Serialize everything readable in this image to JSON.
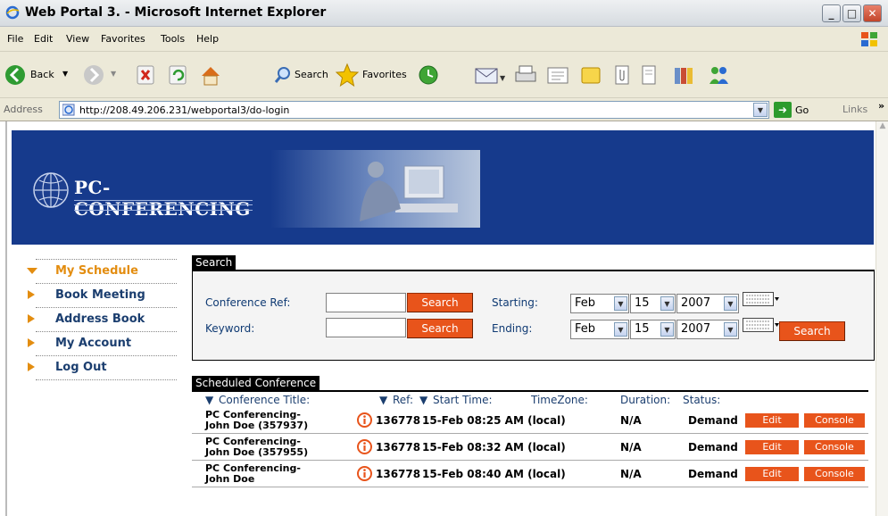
{
  "window": {
    "title": "Web Portal 3. - Microsoft Internet Explorer",
    "buttons": {
      "minimize": "_",
      "maximize": "□",
      "close": "✕"
    }
  },
  "menu": [
    "File",
    "Edit",
    "View",
    "Favorites",
    "Tools",
    "Help"
  ],
  "toolbar": {
    "back": "Back",
    "search": "Search",
    "favorites": "Favorites"
  },
  "address": {
    "label": "Address",
    "url": "http://208.49.206.231/webportal3/do-login",
    "go": "Go",
    "links": "Links",
    "more": "»"
  },
  "banner": {
    "logo_text": "PC-CONFERENCING"
  },
  "nav": {
    "items": [
      {
        "label": "My Schedule",
        "active": true
      },
      {
        "label": "Book Meeting",
        "active": false
      },
      {
        "label": "Address Book",
        "active": false
      },
      {
        "label": "My Account",
        "active": false
      },
      {
        "label": "Log Out",
        "active": false
      }
    ]
  },
  "search": {
    "panel_title": "Search",
    "conf_ref_label": "Conference Ref:",
    "conf_ref_value": "",
    "keyword_label": "Keyword:",
    "keyword_value": "",
    "search_btn": "Search",
    "starting_label": "Starting:",
    "ending_label": "Ending:",
    "start": {
      "month": "Feb",
      "day": "15",
      "year": "2007"
    },
    "end": {
      "month": "Feb",
      "day": "15",
      "year": "2007"
    }
  },
  "schedule": {
    "panel_title": "Scheduled Conference",
    "headers": {
      "title": "Conference Title:",
      "ref": "Ref:",
      "start": "Start Time:",
      "tz": "TimeZone:",
      "duration": "Duration:",
      "status": "Status:"
    },
    "rows": [
      {
        "title_1": "PC Conferencing-",
        "title_2": "John Doe (357937)",
        "ref": "136778",
        "start": "15-Feb 08:25 AM (local)",
        "duration": "N/A",
        "status": "Demand",
        "edit": "Edit",
        "console": "Console"
      },
      {
        "title_1": "PC Conferencing-",
        "title_2": "John Doe (357955)",
        "ref": "136778",
        "start": "15-Feb 08:32 AM (local)",
        "duration": "N/A",
        "status": "Demand",
        "edit": "Edit",
        "console": "Console"
      },
      {
        "title_1": "PC Conferencing-",
        "title_2": "John Doe",
        "ref": "136778",
        "start": "15-Feb 08:40 AM (local)",
        "duration": "N/A",
        "status": "Demand",
        "edit": "Edit",
        "console": "Console"
      }
    ]
  },
  "colors": {
    "banner": "#163a8c",
    "accent_orange": "#e8541b",
    "nav_active": "#e38d10",
    "nav_text": "#1b3e6f"
  }
}
